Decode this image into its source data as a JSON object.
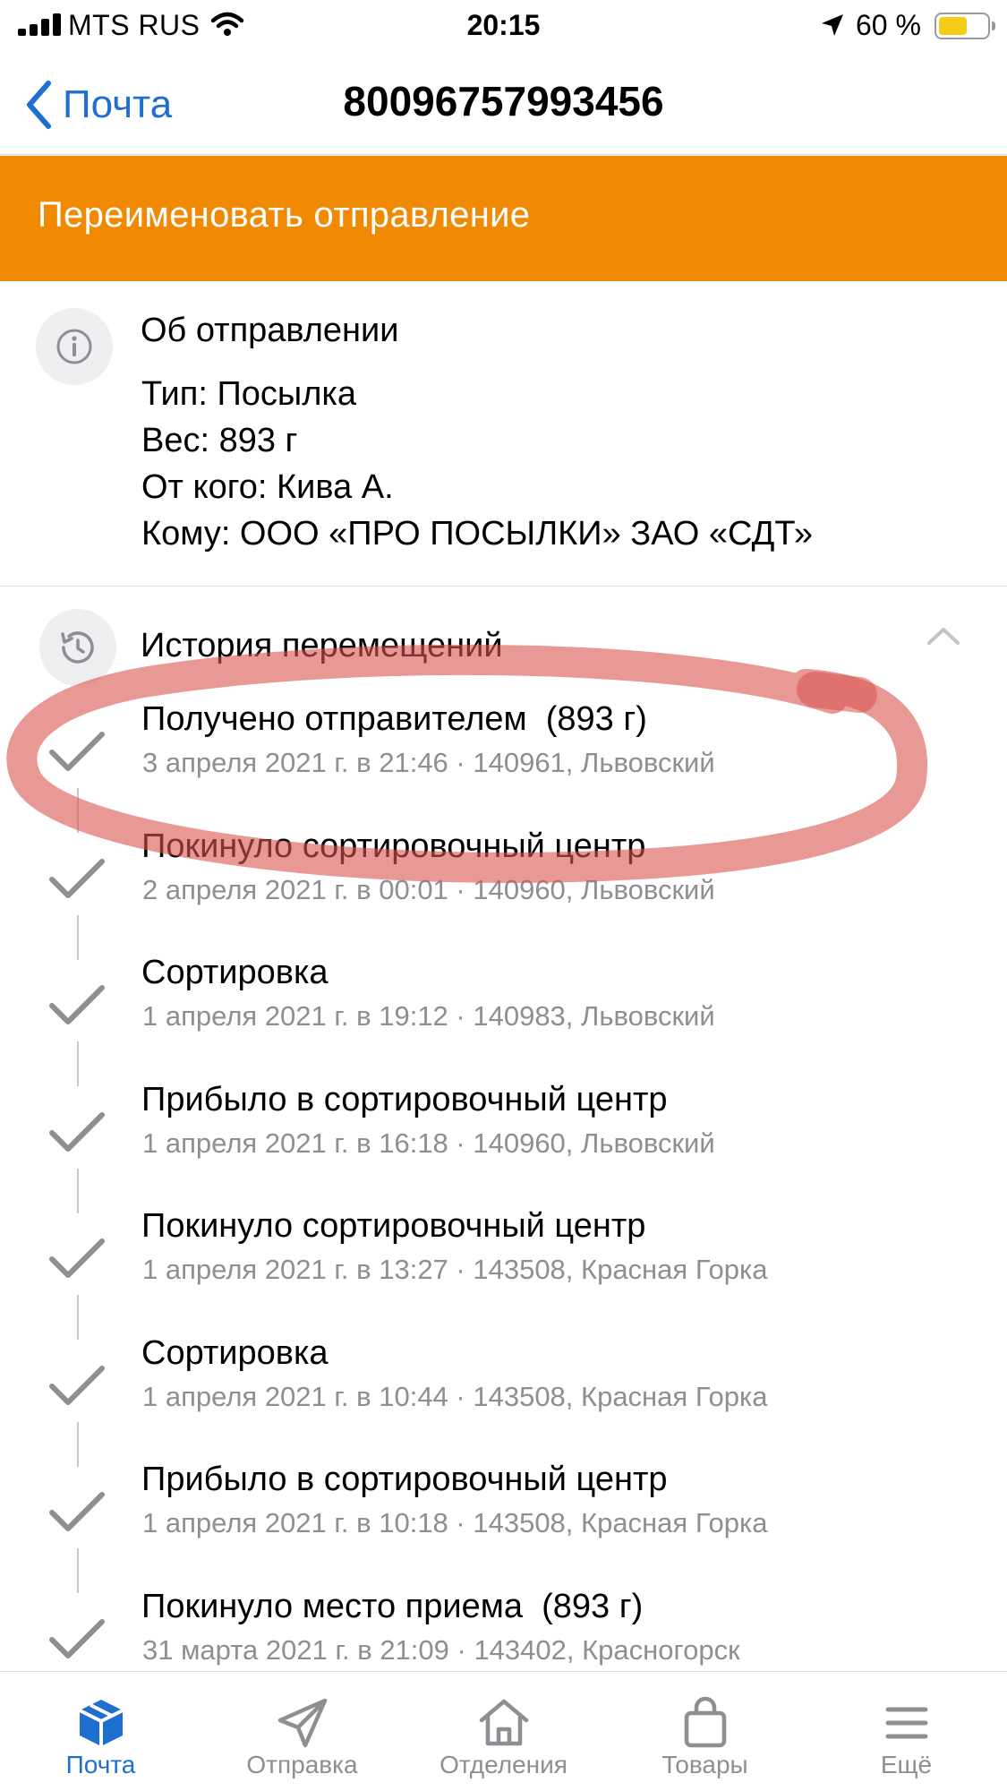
{
  "status_bar": {
    "carrier": "MTS RUS",
    "time": "20:15",
    "battery_percent": "60 %",
    "battery_level": 0.6
  },
  "nav": {
    "back_label": "Почта",
    "title": "80096757993456"
  },
  "rename_banner": {
    "label": "Переименовать отправление",
    "color": "#f08a03"
  },
  "info": {
    "title": "Об отправлении",
    "lines": [
      "Тип: Посылка",
      "Вес: 893 г",
      "От кого: Кива А.",
      "Кому: ООО «ПРО ПОСЫЛКИ» ЗАО «СДТ»"
    ]
  },
  "history": {
    "title": "История перемещений",
    "events": [
      {
        "title": "Получено отправителем  (893 г)",
        "meta": "3 апреля 2021 г. в 21:46 · 140961, Львовский"
      },
      {
        "title": "Покинуло сортировочный центр",
        "meta": "2 апреля 2021 г. в 00:01 · 140960, Львовский"
      },
      {
        "title": "Сортировка",
        "meta": "1 апреля 2021 г. в 19:12 · 140983, Львовский"
      },
      {
        "title": "Прибыло в сортировочный центр",
        "meta": "1 апреля 2021 г. в 16:18 · 140960, Львовский"
      },
      {
        "title": "Покинуло сортировочный центр",
        "meta": "1 апреля 2021 г. в 13:27 · 143508, Красная Горка"
      },
      {
        "title": "Сортировка",
        "meta": "1 апреля 2021 г. в 10:44 · 143508, Красная Горка"
      },
      {
        "title": "Прибыло в сортировочный центр",
        "meta": "1 апреля 2021 г. в 10:18 · 143508, Красная Горка"
      },
      {
        "title": "Покинуло место приема  (893 г)",
        "meta": "31 марта 2021 г. в 21:09 · 143402, Красногорск"
      }
    ]
  },
  "tabs": [
    {
      "label": "Почта",
      "icon": "box-icon",
      "active": true
    },
    {
      "label": "Отправка",
      "icon": "paper-plane-icon",
      "active": false
    },
    {
      "label": "Отделения",
      "icon": "house-icon",
      "active": false
    },
    {
      "label": "Товары",
      "icon": "shopping-bag-icon",
      "active": false
    },
    {
      "label": "Ещё",
      "icon": "menu-icon",
      "active": false
    }
  ],
  "colors": {
    "accent": "#1f6fd1",
    "annotation": "#d9534f",
    "muted_text": "#8e8e93"
  }
}
